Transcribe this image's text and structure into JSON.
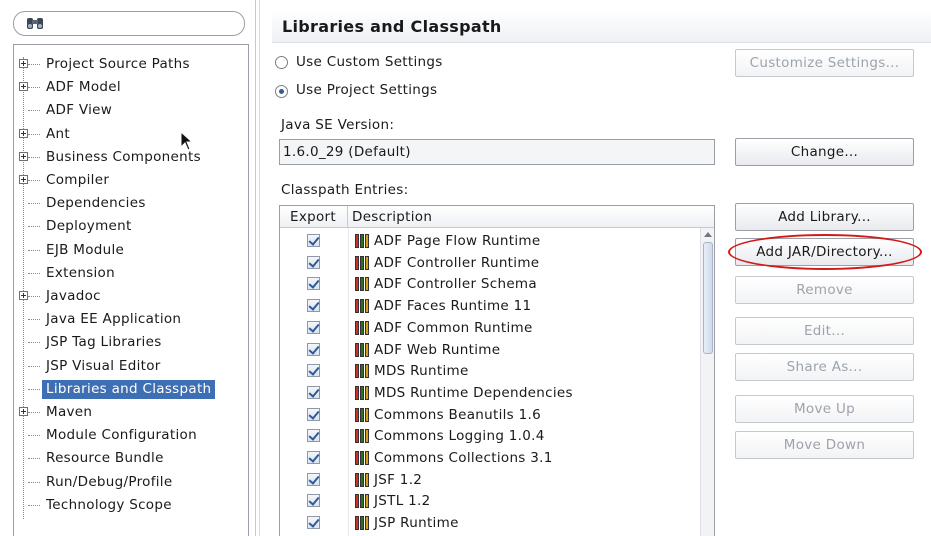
{
  "search": {
    "icon": "binoculars-icon",
    "value": ""
  },
  "tree": {
    "items": [
      {
        "label": "Project Source Paths",
        "expandable": true
      },
      {
        "label": "ADF Model",
        "expandable": true
      },
      {
        "label": "ADF View",
        "expandable": false
      },
      {
        "label": "Ant",
        "expandable": true
      },
      {
        "label": "Business Components",
        "expandable": true
      },
      {
        "label": "Compiler",
        "expandable": true
      },
      {
        "label": "Dependencies",
        "expandable": false
      },
      {
        "label": "Deployment",
        "expandable": false
      },
      {
        "label": "EJB Module",
        "expandable": false
      },
      {
        "label": "Extension",
        "expandable": false
      },
      {
        "label": "Javadoc",
        "expandable": true
      },
      {
        "label": "Java EE Application",
        "expandable": false
      },
      {
        "label": "JSP Tag Libraries",
        "expandable": false
      },
      {
        "label": "JSP Visual Editor",
        "expandable": false
      },
      {
        "label": "Libraries and Classpath",
        "expandable": false,
        "selected": true
      },
      {
        "label": "Maven",
        "expandable": true
      },
      {
        "label": "Module Configuration",
        "expandable": false
      },
      {
        "label": "Resource Bundle",
        "expandable": false
      },
      {
        "label": "Run/Debug/Profile",
        "expandable": false
      },
      {
        "label": "Technology Scope",
        "expandable": false
      }
    ]
  },
  "panel": {
    "title": "Libraries and Classpath",
    "use_custom_label": "Use Custom Settings",
    "use_project_label": "Use Project Settings",
    "selected_setting": "Use Project Settings",
    "customize_button": "Customize Settings...",
    "java_se_label": "Java SE Version:",
    "java_se_value": "1.6.0_29 (Default)",
    "change_button": "Change...",
    "classpath_label": "Classpath Entries:",
    "table": {
      "col_export": "Export",
      "col_description": "Description",
      "rows": [
        {
          "export": true,
          "description": "ADF Page Flow Runtime"
        },
        {
          "export": true,
          "description": "ADF Controller Runtime"
        },
        {
          "export": true,
          "description": "ADF Controller Schema"
        },
        {
          "export": true,
          "description": "ADF Faces Runtime 11"
        },
        {
          "export": true,
          "description": "ADF Common Runtime"
        },
        {
          "export": true,
          "description": "ADF Web Runtime"
        },
        {
          "export": true,
          "description": "MDS Runtime"
        },
        {
          "export": true,
          "description": "MDS Runtime Dependencies"
        },
        {
          "export": true,
          "description": "Commons Beanutils 1.6"
        },
        {
          "export": true,
          "description": "Commons Logging 1.0.4"
        },
        {
          "export": true,
          "description": "Commons Collections 3.1"
        },
        {
          "export": true,
          "description": "JSF 1.2"
        },
        {
          "export": true,
          "description": "JSTL 1.2"
        },
        {
          "export": true,
          "description": "JSP Runtime"
        }
      ]
    },
    "buttons": {
      "add_library": "Add Library...",
      "add_jar": "Add JAR/Directory...",
      "remove": "Remove",
      "edit": "Edit...",
      "share_as": "Share As...",
      "move_up": "Move Up",
      "move_down": "Move Down"
    },
    "annotation_color": "#d21a1a",
    "selection_color": "#3e6fb5"
  }
}
